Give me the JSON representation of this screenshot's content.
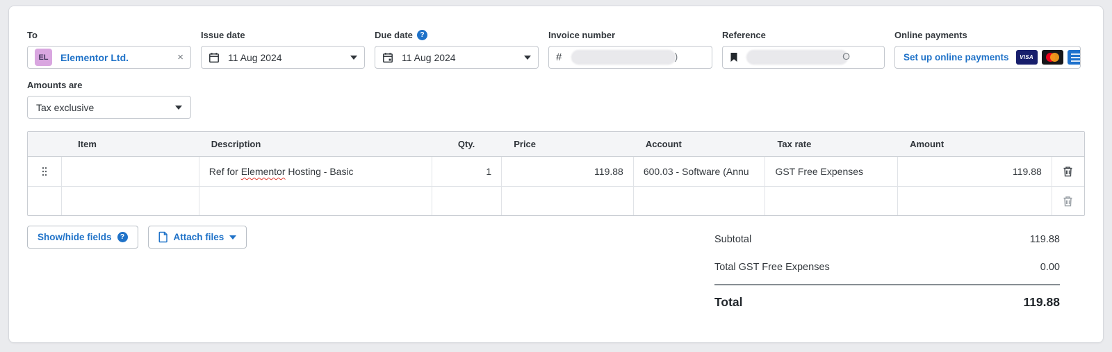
{
  "fields": {
    "to": {
      "label": "To",
      "avatar_initials": "EL",
      "value": "Elementor Ltd.",
      "close_icon": "×"
    },
    "issue_date": {
      "label": "Issue date",
      "value": "11 Aug 2024"
    },
    "due_date": {
      "label": "Due date",
      "value": "11 Aug 2024",
      "help_icon": "?"
    },
    "invoice_number": {
      "label": "Invoice number",
      "prefix": "#",
      "redacted_suffix": ")"
    },
    "reference": {
      "label": "Reference",
      "redacted_suffix": "O"
    },
    "online_payments": {
      "label": "Online payments",
      "link_label": "Set up online payments",
      "visa_label": "VISA"
    },
    "amounts_are": {
      "label": "Amounts are",
      "value": "Tax exclusive"
    }
  },
  "table": {
    "headers": [
      "Item",
      "Description",
      "Qty.",
      "Price",
      "Account",
      "Tax rate",
      "Amount"
    ],
    "rows": [
      {
        "item": "",
        "description_before": "Ref for ",
        "description_misspelled": "Elementor",
        "description_after": " Hosting - Basic",
        "qty": "1",
        "price": "119.88",
        "account": "600.03 - Software (Annu",
        "tax_rate": "GST Free Expenses",
        "amount": "119.88"
      },
      {
        "item": "",
        "description": "",
        "qty": "",
        "price": "",
        "account": "",
        "tax_rate": "",
        "amount": ""
      }
    ]
  },
  "actions": {
    "show_hide_label": "Show/hide fields",
    "show_hide_help_icon": "?",
    "attach_label": "Attach files"
  },
  "totals": {
    "rows": [
      {
        "label": "Subtotal",
        "value": "119.88"
      },
      {
        "label": "Total GST Free Expenses",
        "value": "0.00"
      }
    ],
    "total_label": "Total",
    "total_value": "119.88"
  },
  "colors": {
    "accent_blue": "#1f72c8",
    "avatar_background": "#d9a6e0",
    "spellcheck_red": "#e0392e",
    "visa_background": "#171e6c",
    "mastercard_red": "#eb001b",
    "mastercard_orange": "#f79e1b",
    "amex_blue": "#1f72cd",
    "table_header_background": "#f4f5f7"
  }
}
